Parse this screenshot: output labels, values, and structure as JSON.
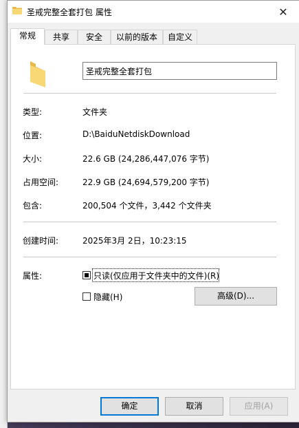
{
  "window": {
    "title": "圣戒完整全套打包 属性",
    "close_glyph": "✕"
  },
  "tabs": [
    {
      "label": "常规",
      "active": true
    },
    {
      "label": "共享",
      "active": false
    },
    {
      "label": "安全",
      "active": false
    },
    {
      "label": "以前的版本",
      "active": false
    },
    {
      "label": "自定义",
      "active": false
    }
  ],
  "general": {
    "folder_name": "圣戒完整全套打包",
    "type_label": "类型:",
    "type_value": "文件夹",
    "location_label": "位置:",
    "location_value": "D:\\BaiduNetdiskDownload",
    "size_label": "大小:",
    "size_value": "22.6 GB (24,286,447,076 字节)",
    "disk_size_label": "占用空间:",
    "disk_size_value": "22.9 GB (24,694,579,200 字节)",
    "contains_label": "包含:",
    "contains_value": "200,504 个文件，3,442 个文件夹",
    "created_label": "创建时间:",
    "created_value": "2025年3月 2日，10:23:15",
    "attributes_label": "属性:",
    "readonly_label": "只读(仅应用于文件夹中的文件)(R)",
    "readonly_state": "indeterminate",
    "hidden_label": "隐藏(H)",
    "hidden_state": "unchecked",
    "advanced_label": "高级(D)..."
  },
  "footer": {
    "ok_label": "确定",
    "cancel_label": "取消",
    "apply_label": "应用(A)"
  },
  "colors": {
    "folder_yellow": "#f8d775",
    "folder_dark": "#e8b84a",
    "default_button_border": "#0078d7"
  }
}
